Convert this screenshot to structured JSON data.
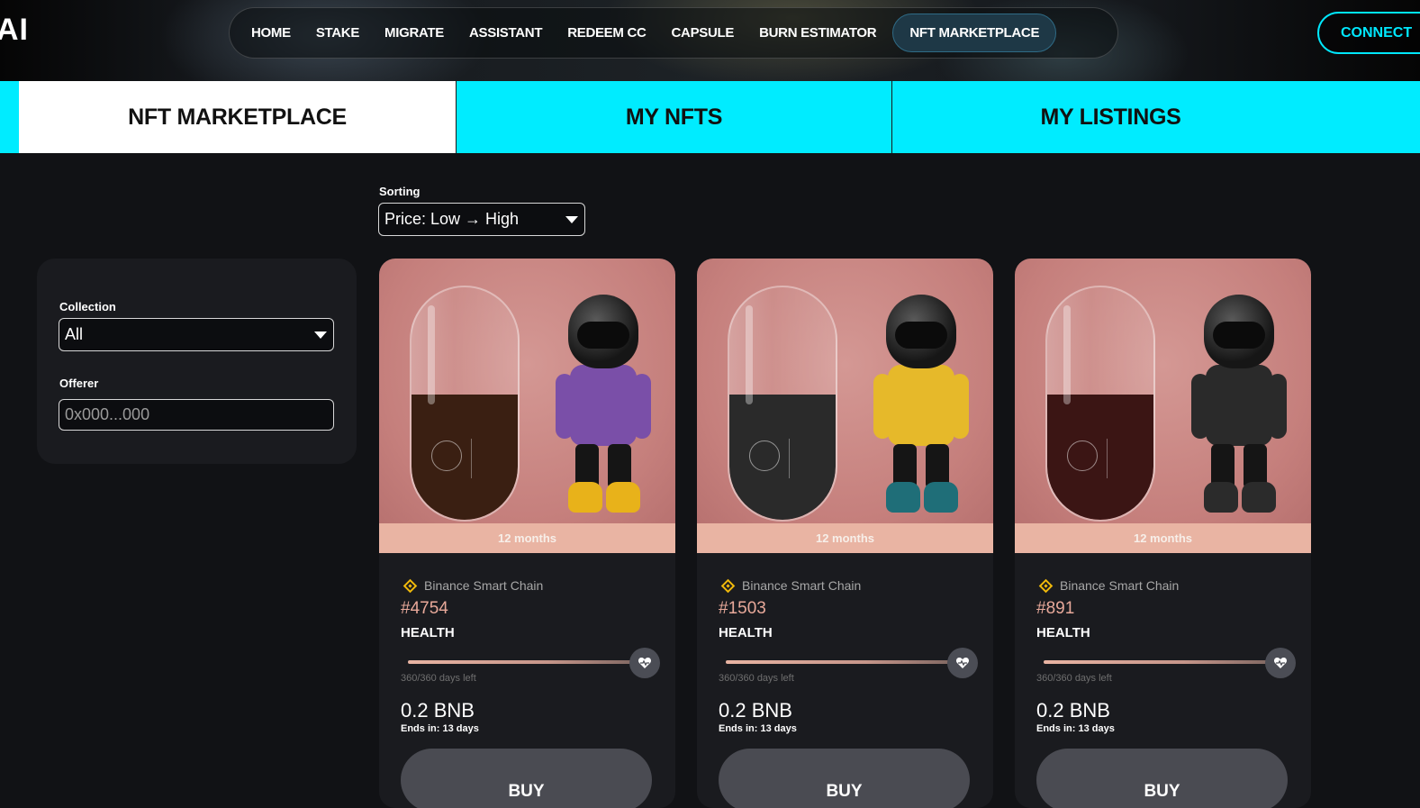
{
  "app": {
    "logo_text": "AI"
  },
  "nav": {
    "items": [
      {
        "label": "HOME"
      },
      {
        "label": "STAKE"
      },
      {
        "label": "MIGRATE"
      },
      {
        "label": "ASSISTANT"
      },
      {
        "label": "REDEEM CC"
      },
      {
        "label": "CAPSULE"
      },
      {
        "label": "BURN ESTIMATOR"
      },
      {
        "label": "NFT MARKETPLACE",
        "active": true
      }
    ],
    "connect_label": "CONNECT"
  },
  "tabs": [
    {
      "label": "NFT MARKETPLACE",
      "active": true
    },
    {
      "label": "MY NFTS",
      "active": false
    },
    {
      "label": "MY LISTINGS",
      "active": false
    }
  ],
  "sorting": {
    "label": "Sorting",
    "selected": "Price: Low → High"
  },
  "filters": {
    "collection_label": "Collection",
    "collection_selected": "All",
    "offerer_label": "Offerer",
    "offerer_placeholder": "0x000...000"
  },
  "listings": [
    {
      "duration": "12 months",
      "chain": "Binance Smart Chain",
      "token_id": "#4754",
      "health_label": "HEALTH",
      "health_fraction": 1.0,
      "days_left": "360/360 days left",
      "price": "0.2 BNB",
      "ends_label": "Ends in:",
      "ends_value": "13 days",
      "buy_label": "BUY",
      "capsule_liquid_color": "#3a1f12",
      "shirt_color": "#7a4fa8",
      "shoe_color": "#e8b21a"
    },
    {
      "duration": "12 months",
      "chain": "Binance Smart Chain",
      "token_id": "#1503",
      "health_label": "HEALTH",
      "health_fraction": 1.0,
      "days_left": "360/360 days left",
      "price": "0.2 BNB",
      "ends_label": "Ends in:",
      "ends_value": "13 days",
      "buy_label": "BUY",
      "capsule_liquid_color": "#2a2a2a",
      "shirt_color": "#e6b92a",
      "shoe_color": "#1f6e78"
    },
    {
      "duration": "12 months",
      "chain": "Binance Smart Chain",
      "token_id": "#891",
      "health_label": "HEALTH",
      "health_fraction": 1.0,
      "days_left": "360/360 days left",
      "price": "0.2 BNB",
      "ends_label": "Ends in:",
      "ends_value": "13 days",
      "buy_label": "BUY",
      "capsule_liquid_color": "#3b1514",
      "shirt_color": "#2a2a2a",
      "shoe_color": "#2b2b2b"
    }
  ],
  "colors": {
    "accent": "#00ecff",
    "card_bg": "#1a1b1f",
    "card_art_bg": "#c57f7c",
    "token_id": "#e8a99a",
    "chain_icon": "#f0b90b"
  }
}
